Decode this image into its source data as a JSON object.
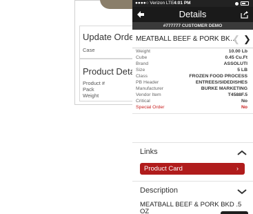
{
  "background_panel": {
    "update_order": {
      "title": "Update Order",
      "fields": [
        "Case"
      ]
    },
    "product_details": {
      "title": "Product Details",
      "fields": [
        "Product #",
        "Pack",
        "Weight"
      ]
    }
  },
  "status_bar": {
    "carrier": "●●●●○ Verizon  LTE",
    "time": "4:01 PM"
  },
  "nav": {
    "title": "Details"
  },
  "customer": {
    "label": "#777777 CUSTOMER DEMO"
  },
  "product": {
    "name": "MEATBALL BEEF & PORK BK…"
  },
  "specs": [
    {
      "label": "Weight",
      "value": "10.00 Lb"
    },
    {
      "label": "Cube",
      "value": "0.45 Cu.Ft"
    },
    {
      "label": "Brand",
      "value": "ASSOLUTI"
    },
    {
      "label": "Size",
      "value": "5 LB"
    },
    {
      "label": "Class",
      "value": "FROZEN FOOD PROCESS"
    },
    {
      "label": "PB Header",
      "value": "ENTREES/SIDEDISHES"
    },
    {
      "label": "Manufacturer",
      "value": "BURKE MARKETING"
    },
    {
      "label": "Vendor Item",
      "value": "T4588F.5"
    },
    {
      "label": "Critical",
      "value": "No"
    },
    {
      "label": "Special Order",
      "value": "No"
    }
  ],
  "links": {
    "title": "Links",
    "product_card": "Product Card",
    "arrow": "›"
  },
  "description": {
    "title": "Description",
    "text": "MEATBALL BEEF & PORK BKD .5 OZ"
  },
  "colors": {
    "accent": "#b01c1c",
    "nav_bg": "#1a1a1a",
    "subbar_bg": "#3a3a3a",
    "special": "#c81e1e"
  },
  "icons": {
    "back": "arrow-left",
    "share": "share-box",
    "prev": "chevron-left",
    "next": "chevron-right",
    "links_toggle": "chevron-up",
    "description_toggle": "chevron-down"
  }
}
